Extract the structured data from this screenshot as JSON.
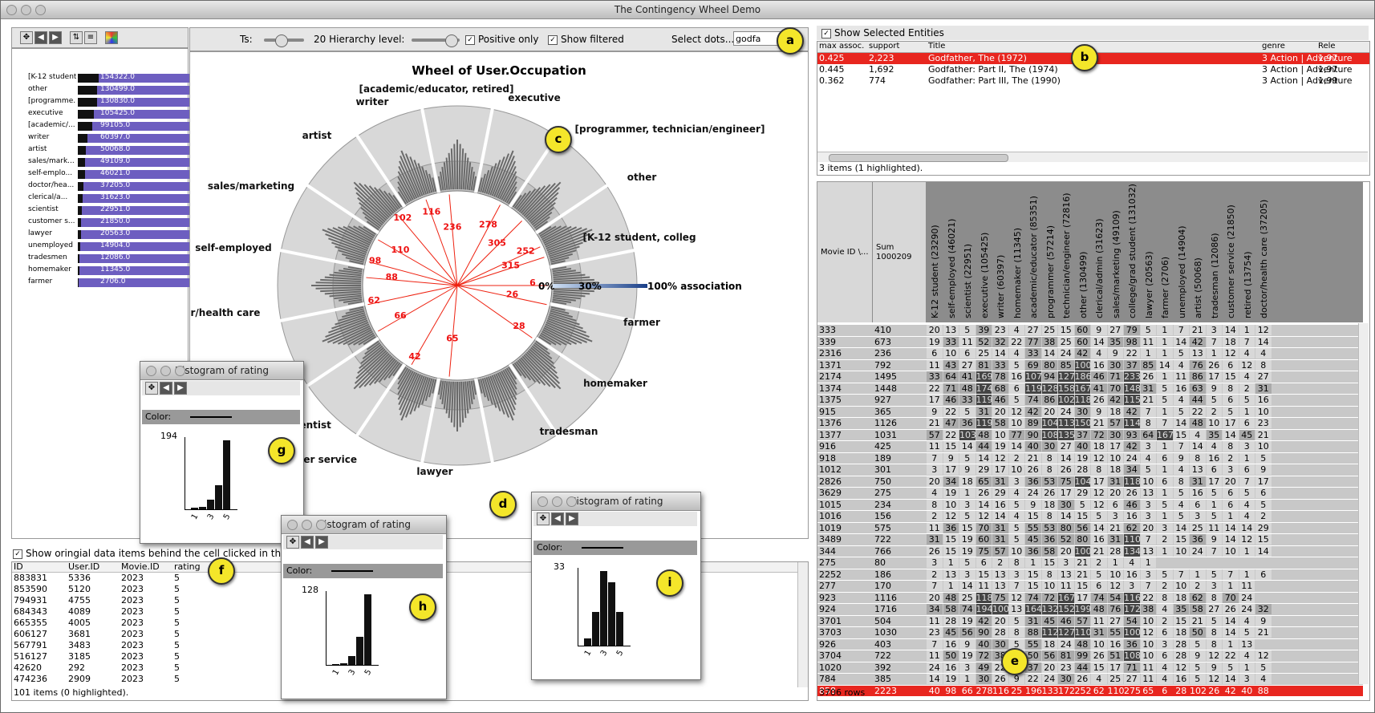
{
  "window_title": "The Contingency Wheel Demo",
  "toolbar": {
    "ts_label": "Ts:",
    "hierarchy_label": "20 Hierarchy level:",
    "positive_only": "Positive only",
    "show_filtered": "Show filtered",
    "select_dots_label": "Select dots...",
    "select_dots_value": "godfa"
  },
  "left_list": [
    {
      "name": "[K-12 student...",
      "value": "154322.0"
    },
    {
      "name": "other",
      "value": "130499.0"
    },
    {
      "name": "[programme...",
      "value": "130830.0"
    },
    {
      "name": "executive",
      "value": "105425.0"
    },
    {
      "name": "[academic/...",
      "value": "99105.0"
    },
    {
      "name": "writer",
      "value": "60397.0"
    },
    {
      "name": "artist",
      "value": "50068.0"
    },
    {
      "name": "sales/mark...",
      "value": "49109.0"
    },
    {
      "name": "self-emplo...",
      "value": "46021.0"
    },
    {
      "name": "doctor/hea...",
      "value": "37205.0"
    },
    {
      "name": "clerical/a...",
      "value": "31623.0"
    },
    {
      "name": "scientist",
      "value": "22951.0"
    },
    {
      "name": "customer s...",
      "value": "21850.0"
    },
    {
      "name": "lawyer",
      "value": "20563.0"
    },
    {
      "name": "unemployed",
      "value": "14904.0"
    },
    {
      "name": "tradesmen",
      "value": "12086.0"
    },
    {
      "name": "homemaker",
      "value": "11345.0"
    },
    {
      "name": "farmer",
      "value": "2706.0"
    }
  ],
  "wheel": {
    "title": "Wheel of User.Occupation",
    "labels": [
      "[academic/educator, retired]",
      "writer",
      "executive",
      "[programmer, technician/engineer]",
      "artist",
      "other",
      "sales/marketing",
      "[K-12 student, colleg",
      "self-employed",
      "doctor/health care",
      "farmer",
      "homemaker",
      "scientist",
      "tradesman",
      "customer service",
      "lawyer"
    ],
    "numbers": [
      "236",
      "278",
      "116",
      "102",
      "305",
      "110",
      "252",
      "98",
      "315",
      "88",
      "6",
      "62",
      "26",
      "66",
      "28",
      "42",
      "65"
    ],
    "scale_0": "0%",
    "scale_30": "30%",
    "scale_100": "100% association",
    "cut_label": "n"
  },
  "show_original": "Show oringial data items behind the cell clicked in the c",
  "data_table": {
    "headers": [
      "ID",
      "User.ID",
      "Movie.ID",
      "rating"
    ],
    "rows": [
      [
        "883831",
        "5336",
        "2023",
        "5"
      ],
      [
        "853590",
        "5120",
        "2023",
        "5"
      ],
      [
        "794931",
        "4755",
        "2023",
        "5"
      ],
      [
        "684343",
        "4089",
        "2023",
        "5"
      ],
      [
        "665355",
        "4005",
        "2023",
        "5"
      ],
      [
        "606127",
        "3681",
        "2023",
        "5"
      ],
      [
        "567791",
        "3483",
        "2023",
        "5"
      ],
      [
        "516127",
        "3185",
        "2023",
        "5"
      ],
      [
        "42620",
        "292",
        "2023",
        "5"
      ],
      [
        "474236",
        "2909",
        "2023",
        "5"
      ]
    ],
    "footer": "101 items (0 highlighted)."
  },
  "selected_entities": {
    "checkbox": "Show Selected Entities",
    "headers": [
      "max assoc.",
      "support",
      "Title",
      "genre",
      "Rele"
    ],
    "rows": [
      [
        "0.425",
        "2,223",
        "Godfather, The (1972)",
        "3 Action | Adventure",
        "1,97"
      ],
      [
        "0.445",
        "1,692",
        "Godfather: Part II, The (1974)",
        "3 Action | Adventure",
        "1,97"
      ],
      [
        "0.362",
        "774",
        "Godfather: Part III, The (1990)",
        "3 Action | Adventure",
        "1,99"
      ]
    ],
    "footer": "3 items (1 highlighted)."
  },
  "matrix": {
    "corner1": "Movie ID \\...",
    "corner2": "Sum",
    "corner2_sub": "1000209",
    "columns": [
      "K-12 student (23290)",
      "self-employed (46021)",
      "scientist (22951)",
      "executive (105425)",
      "writer (60397)",
      "homemaker (11345)",
      "academic/educator (85351)",
      "programmer (57214)",
      "technician/engineer (72816)",
      "other (130499)",
      "clerical/admin (31623)",
      "sales/marketing (49109)",
      "college/grad student (131032)",
      "lawyer (20563)",
      "farmer (2706)",
      "unemployed (14904)",
      "artist (50068)",
      "tradesman (12086)",
      "customer service (21850)",
      "retired (13754)",
      "doctor/health care (37205)"
    ],
    "rows": [
      [
        "333",
        "410",
        "20",
        "13",
        "5",
        "39",
        "23",
        "4",
        "27",
        "25",
        "15",
        "60",
        "9",
        "27",
        "79",
        "5",
        "1",
        "7",
        "21",
        "3",
        "14",
        "1",
        "12"
      ],
      [
        "339",
        "673",
        "19",
        "33",
        "11",
        "52",
        "32",
        "22",
        "77",
        "38",
        "25",
        "60",
        "14",
        "35",
        "98",
        "11",
        "1",
        "14",
        "42",
        "7",
        "18",
        "7",
        "14"
      ],
      [
        "2316",
        "236",
        "6",
        "10",
        "6",
        "25",
        "14",
        "4",
        "33",
        "14",
        "24",
        "42",
        "4",
        "9",
        "22",
        "1",
        "1",
        "5",
        "13",
        "1",
        "12",
        "4",
        "4"
      ],
      [
        "1371",
        "792",
        "11",
        "43",
        "27",
        "81",
        "33",
        "5",
        "69",
        "80",
        "85",
        "100",
        "16",
        "30",
        "37",
        "85",
        "14",
        "4",
        "76",
        "26",
        "6",
        "12",
        "8"
      ],
      [
        "2174",
        "1495",
        "33",
        "64",
        "41",
        "169",
        "78",
        "16",
        "107",
        "94",
        "127",
        "186",
        "46",
        "71",
        "233",
        "26",
        "1",
        "11",
        "86",
        "17",
        "15",
        "4",
        "27"
      ],
      [
        "1374",
        "1448",
        "22",
        "71",
        "48",
        "174",
        "68",
        "6",
        "119",
        "128",
        "158",
        "167",
        "41",
        "70",
        "148",
        "31",
        "5",
        "16",
        "63",
        "9",
        "8",
        "2",
        "31"
      ],
      [
        "1375",
        "927",
        "17",
        "46",
        "33",
        "119",
        "46",
        "5",
        "74",
        "86",
        "102",
        "118",
        "26",
        "42",
        "115",
        "21",
        "5",
        "4",
        "44",
        "5",
        "6",
        "5",
        "16"
      ],
      [
        "915",
        "365",
        "9",
        "22",
        "5",
        "31",
        "20",
        "12",
        "42",
        "20",
        "24",
        "30",
        "9",
        "18",
        "42",
        "7",
        "1",
        "5",
        "22",
        "2",
        "5",
        "1",
        "10"
      ],
      [
        "1376",
        "1126",
        "21",
        "47",
        "36",
        "119",
        "58",
        "10",
        "89",
        "104",
        "113",
        "150",
        "21",
        "57",
        "114",
        "8",
        "7",
        "14",
        "48",
        "10",
        "17",
        "6",
        "23"
      ],
      [
        "1377",
        "1031",
        "57",
        "22",
        "103",
        "48",
        "10",
        "77",
        "90",
        "108",
        "135",
        "37",
        "72",
        "30",
        "93",
        "64",
        "167",
        "15",
        "4",
        "35",
        "14",
        "45",
        "21"
      ],
      [
        "916",
        "425",
        "11",
        "15",
        "14",
        "44",
        "19",
        "14",
        "40",
        "30",
        "27",
        "40",
        "18",
        "17",
        "42",
        "3",
        "1",
        "7",
        "14",
        "4",
        "8",
        "3",
        "10"
      ],
      [
        "918",
        "189",
        "7",
        "9",
        "5",
        "14",
        "12",
        "2",
        "21",
        "8",
        "14",
        "19",
        "12",
        "10",
        "24",
        "4",
        "6",
        "9",
        "8",
        "16",
        "2",
        "1",
        "5"
      ],
      [
        "1012",
        "301",
        "3",
        "17",
        "9",
        "29",
        "17",
        "10",
        "26",
        "8",
        "26",
        "28",
        "8",
        "18",
        "34",
        "5",
        "1",
        "4",
        "13",
        "6",
        "3",
        "6",
        "9"
      ],
      [
        "2826",
        "750",
        "20",
        "34",
        "18",
        "65",
        "31",
        "3",
        "36",
        "53",
        "75",
        "104",
        "17",
        "31",
        "118",
        "10",
        "6",
        "8",
        "31",
        "17",
        "20",
        "7",
        "17"
      ],
      [
        "3629",
        "275",
        "4",
        "19",
        "1",
        "26",
        "29",
        "4",
        "24",
        "26",
        "17",
        "29",
        "12",
        "20",
        "26",
        "13",
        "1",
        "5",
        "16",
        "5",
        "6",
        "5",
        "6"
      ],
      [
        "1015",
        "234",
        "8",
        "10",
        "3",
        "14",
        "16",
        "5",
        "9",
        "18",
        "30",
        "5",
        "12",
        "6",
        "46",
        "3",
        "5",
        "4",
        "6",
        "1",
        "6",
        "4",
        "5"
      ],
      [
        "1016",
        "156",
        "2",
        "12",
        "5",
        "12",
        "14",
        "4",
        "15",
        "8",
        "14",
        "15",
        "5",
        "3",
        "16",
        "3",
        "1",
        "5",
        "3",
        "5",
        "1",
        "4",
        "2"
      ],
      [
        "1019",
        "575",
        "11",
        "36",
        "15",
        "70",
        "31",
        "5",
        "55",
        "53",
        "80",
        "56",
        "14",
        "21",
        "62",
        "20",
        "3",
        "14",
        "25",
        "11",
        "14",
        "14",
        "29"
      ],
      [
        "3489",
        "722",
        "31",
        "15",
        "19",
        "60",
        "31",
        "5",
        "45",
        "36",
        "52",
        "80",
        "16",
        "31",
        "110",
        "7",
        "2",
        "15",
        "36",
        "9",
        "14",
        "12",
        "15"
      ],
      [
        "344",
        "766",
        "26",
        "15",
        "19",
        "75",
        "57",
        "10",
        "36",
        "58",
        "20",
        "100",
        "21",
        "28",
        "134",
        "13",
        "1",
        "10",
        "24",
        "7",
        "10",
        "1",
        "14"
      ],
      [
        "275",
        "80",
        "3",
        "1",
        "5",
        "6",
        "2",
        "8",
        "1",
        "15",
        "3",
        "21",
        "2",
        "1",
        "4",
        "1"
      ],
      [
        "2252",
        "186",
        "2",
        "13",
        "3",
        "15",
        "13",
        "3",
        "15",
        "8",
        "13",
        "21",
        "5",
        "10",
        "16",
        "3",
        "5",
        "7",
        "1",
        "5",
        "7",
        "1",
        "6"
      ],
      [
        "277",
        "170",
        "7",
        "1",
        "14",
        "11",
        "13",
        "7",
        "15",
        "10",
        "11",
        "15",
        "6",
        "12",
        "3",
        "7",
        "2",
        "10",
        "2",
        "3",
        "1",
        "11"
      ],
      [
        "923",
        "1116",
        "20",
        "48",
        "25",
        "118",
        "75",
        "12",
        "74",
        "72",
        "167",
        "17",
        "74",
        "54",
        "116",
        "22",
        "8",
        "18",
        "62",
        "8",
        "70",
        "24"
      ],
      [
        "924",
        "1716",
        "34",
        "58",
        "74",
        "194",
        "100",
        "13",
        "164",
        "132",
        "152",
        "199",
        "48",
        "76",
        "172",
        "38",
        "4",
        "35",
        "58",
        "27",
        "26",
        "24",
        "32"
      ],
      [
        "3701",
        "504",
        "11",
        "28",
        "19",
        "42",
        "20",
        "5",
        "31",
        "45",
        "46",
        "57",
        "11",
        "27",
        "54",
        "10",
        "2",
        "15",
        "21",
        "5",
        "14",
        "4",
        "9"
      ],
      [
        "3703",
        "1030",
        "23",
        "45",
        "56",
        "90",
        "28",
        "8",
        "88",
        "112",
        "127",
        "110",
        "31",
        "55",
        "100",
        "12",
        "6",
        "18",
        "50",
        "8",
        "14",
        "5",
        "21"
      ],
      [
        "926",
        "403",
        "7",
        "16",
        "9",
        "40",
        "30",
        "5",
        "55",
        "18",
        "24",
        "48",
        "10",
        "16",
        "36",
        "10",
        "3",
        "28",
        "5",
        "8",
        "1",
        "13"
      ],
      [
        "3704",
        "722",
        "11",
        "50",
        "19",
        "72",
        "38",
        "6",
        "50",
        "56",
        "81",
        "99",
        "26",
        "51",
        "108",
        "10",
        "6",
        "28",
        "9",
        "12",
        "22",
        "4",
        "12"
      ],
      [
        "1020",
        "392",
        "24",
        "16",
        "3",
        "49",
        "22",
        "7",
        "37",
        "20",
        "23",
        "44",
        "15",
        "17",
        "71",
        "11",
        "4",
        "12",
        "5",
        "9",
        "5",
        "1",
        "5"
      ],
      [
        "784",
        "385",
        "14",
        "19",
        "1",
        "30",
        "26",
        "9",
        "22",
        "24",
        "30",
        "26",
        "4",
        "25",
        "27",
        "11",
        "4",
        "16",
        "5",
        "12",
        "14",
        "3",
        "4"
      ],
      [
        "858",
        "2223",
        "40",
        "98",
        "66",
        "278",
        "116",
        "25",
        "196",
        "133",
        "172",
        "252",
        "62",
        "110",
        "275",
        "65",
        "6",
        "28",
        "102",
        "26",
        "42",
        "40",
        "88"
      ]
    ],
    "footer": "3706 rows"
  },
  "histograms": [
    {
      "title": "Histogram of rating",
      "ymax": "194",
      "values": [
        2,
        4,
        14,
        35,
        100
      ]
    },
    {
      "title": "Histogram of rating",
      "ymax": "128",
      "values": [
        1,
        2,
        12,
        40,
        100
      ]
    },
    {
      "title": "Histogram of rating",
      "ymax": "33",
      "values": [
        10,
        45,
        100,
        85,
        45
      ]
    }
  ],
  "hist_color_label": "Color:",
  "hist_ticks": [
    "1",
    "3",
    "5"
  ],
  "badges": [
    "a",
    "b",
    "c",
    "d",
    "e",
    "f",
    "g",
    "h",
    "i"
  ]
}
